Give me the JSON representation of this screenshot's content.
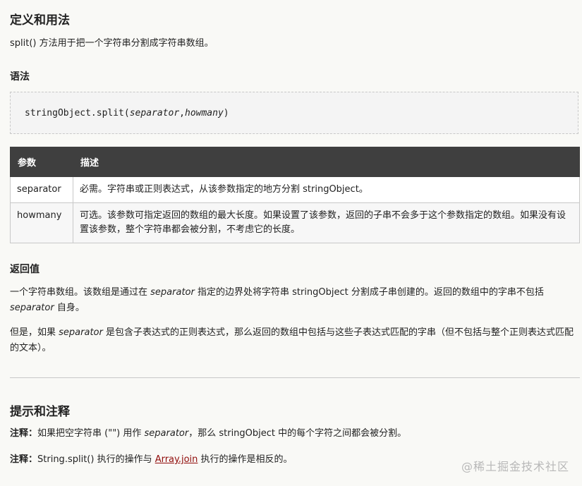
{
  "section_def": {
    "title": "定义和用法",
    "desc": "split() 方法用于把一个字符串分割成字符串数组。"
  },
  "syntax": {
    "title": "语法",
    "code_prefix": "stringObject.split(",
    "param1": "separator",
    "comma": ",",
    "param2": "howmany",
    "code_suffix": ")"
  },
  "params_table": {
    "headers": [
      "参数",
      "描述"
    ],
    "rows": [
      {
        "name": "separator",
        "desc": "必需。字符串或正则表达式，从该参数指定的地方分割 stringObject。"
      },
      {
        "name": "howmany",
        "desc": "可选。该参数可指定返回的数组的最大长度。如果设置了该参数，返回的子串不会多于这个参数指定的数组。如果没有设置该参数，整个字符串都会被分割，不考虑它的长度。"
      }
    ]
  },
  "return_value": {
    "title": "返回值",
    "p1_a": "一个字符串数组。该数组是通过在 ",
    "p1_em": "separator",
    "p1_b": " 指定的边界处将字符串 stringObject 分割成子串创建的。返回的数组中的字串不包括 ",
    "p1_em2": "separator",
    "p1_c": " 自身。",
    "p2_a": "但是，如果 ",
    "p2_em": "separator",
    "p2_b": " 是包含子表达式的正则表达式，那么返回的数组中包括与这些子表达式匹配的字串（但不包括与整个正则表达式匹配的文本）。"
  },
  "tips": {
    "title": "提示和注释",
    "note1_label": "注释：",
    "note1_a": "如果把空字符串 (\"\") 用作 ",
    "note1_em": "separator",
    "note1_b": "，那么 stringObject 中的每个字符之间都会被分割。",
    "note2_label": "注释：",
    "note2_a": "String.split() 执行的操作与 ",
    "note2_link": "Array.join",
    "note2_b": " 执行的操作是相反的。"
  },
  "watermark": "@稀土掘金技术社区"
}
